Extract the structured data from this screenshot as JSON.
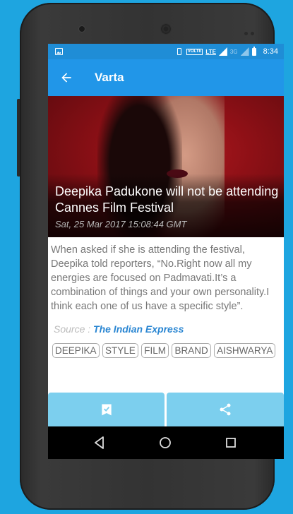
{
  "status_bar": {
    "volte": "VOLTE",
    "lte": "LTE",
    "network_3g": "3G",
    "time": "8:34"
  },
  "app_bar": {
    "title": "Varta"
  },
  "article": {
    "headline": "Deepika Padukone will not be attending Cannes Film Festival",
    "date": "Sat, 25 Mar 2017 15:08:44 GMT",
    "body": "When asked if she is attending the festival, Deepika told reporters, “No.Right now all my energies are focused on Padmavati.It’s a combination of things and your own personality.I think each one of us have a specific style”.",
    "source_label": "Source :",
    "source_name": "The Indian Express",
    "tags": [
      "DEEPIKA",
      "STYLE",
      "FILM",
      "BRAND",
      "AISHWARYA"
    ]
  },
  "icons": {
    "bookmark": "bookmark-check-icon",
    "share": "share-icon",
    "back": "arrow-back-icon"
  },
  "colors": {
    "status_bar": "#1f8dd6",
    "app_bar": "#2196e8",
    "action_button": "#7ccfee",
    "source_link": "#2a86d2",
    "background": "#1ea5e0"
  }
}
